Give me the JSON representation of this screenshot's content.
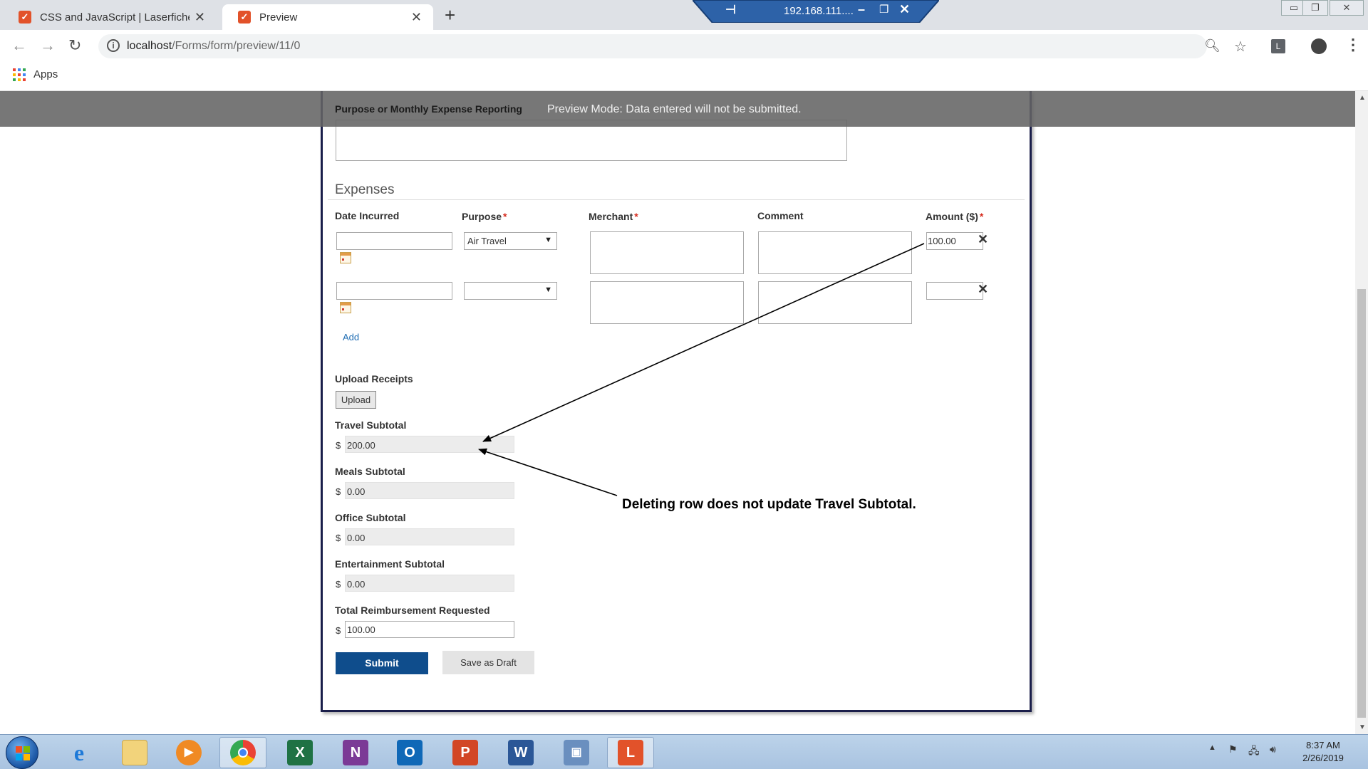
{
  "browser": {
    "tabs": [
      {
        "title": "CSS and JavaScript | Laserfiche Fo",
        "active": false
      },
      {
        "title": "Preview",
        "active": true
      }
    ],
    "url_host": "localhost",
    "url_path": "/Forms/form/preview/11/0",
    "bookmarks": {
      "apps_label": "Apps"
    }
  },
  "remote_desktop": {
    "title": "192.168.111...."
  },
  "banner": {
    "section_label": "Purpose or Monthly Expense Reporting",
    "preview_text": "Preview Mode: Data entered will not be submitted."
  },
  "form": {
    "purpose_textarea_value": "",
    "expenses": {
      "title": "Expenses",
      "columns": {
        "date": "Date Incurred",
        "purpose": "Purpose",
        "merchant": "Merchant",
        "comment": "Comment",
        "amount": "Amount ($)"
      },
      "required_mark": "*",
      "rows": [
        {
          "date": "",
          "purpose": "Air Travel",
          "merchant": "",
          "comment": "",
          "amount": "100.00"
        },
        {
          "date": "",
          "purpose": "",
          "merchant": "",
          "comment": "",
          "amount": ""
        }
      ],
      "add_label": "Add"
    },
    "upload": {
      "label": "Upload Receipts",
      "button": "Upload"
    },
    "currency_symbol": "$",
    "subtotals": [
      {
        "label": "Travel Subtotal",
        "value": "200.00"
      },
      {
        "label": "Meals Subtotal",
        "value": "0.00"
      },
      {
        "label": "Office Subtotal",
        "value": "0.00"
      },
      {
        "label": "Entertainment Subtotal",
        "value": "0.00"
      }
    ],
    "total": {
      "label": "Total Reimbursement Requested",
      "value": "100.00"
    },
    "submit_label": "Submit",
    "draft_label": "Save as Draft"
  },
  "annotation": {
    "text": "Deleting row does not update Travel Subtotal."
  },
  "taskbar": {
    "clock_time": "8:37 AM",
    "clock_date": "2/26/2019",
    "apps": [
      "internet-explorer",
      "file-explorer",
      "media-player",
      "chrome",
      "excel",
      "onenote",
      "outlook",
      "powerpoint",
      "word",
      "remote-desktop",
      "laserfiche"
    ]
  },
  "colors": {
    "submit_button": "#0f4d8c",
    "required_asterisk": "#d62d20",
    "add_link": "#1f6db3",
    "form_border": "#1a1e4a"
  }
}
